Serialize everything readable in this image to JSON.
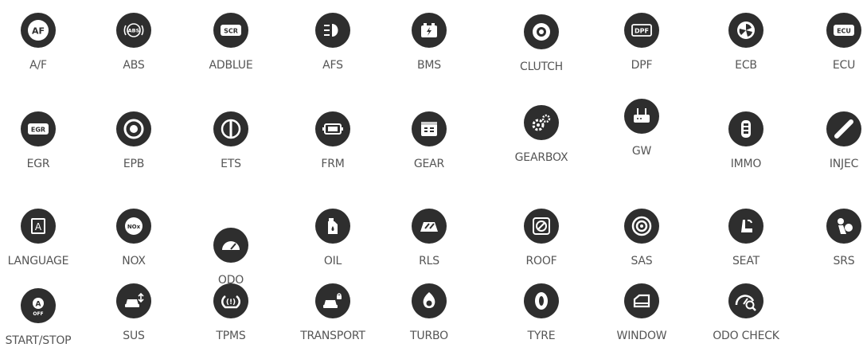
{
  "functions": [
    {
      "label": "A/F",
      "icon": "af-icon",
      "glyph": "AF"
    },
    {
      "label": "ABS",
      "icon": "abs-icon",
      "glyph": "ABS"
    },
    {
      "label": "ADBLUE",
      "icon": "scr-icon",
      "glyph": "SCR"
    },
    {
      "label": "AFS",
      "icon": "headlight-icon"
    },
    {
      "label": "BMS",
      "icon": "battery-icon"
    },
    {
      "label": "CLUTCH",
      "icon": "clutch-icon"
    },
    {
      "label": "DPF",
      "icon": "dpf-icon",
      "glyph": "DPF"
    },
    {
      "label": "ECB",
      "icon": "ecb-icon"
    },
    {
      "label": "ECU",
      "icon": "ecu-icon",
      "glyph": "ECU"
    },
    {
      "label": "EGR",
      "icon": "egr-icon",
      "glyph": "EGR"
    },
    {
      "label": "EPB",
      "icon": "parking-brake-icon"
    },
    {
      "label": "ETS",
      "icon": "throttle-icon"
    },
    {
      "label": "FRM",
      "icon": "frm-module-icon"
    },
    {
      "label": "GEAR",
      "icon": "gear-window-icon"
    },
    {
      "label": "GEARBOX",
      "icon": "gearbox-icon"
    },
    {
      "label": "GW",
      "icon": "gateway-icon"
    },
    {
      "label": "IMMO",
      "icon": "key-fob-icon"
    },
    {
      "label": "INJEC",
      "icon": "injector-icon"
    },
    {
      "label": "LANGUAGE",
      "icon": "language-icon",
      "glyph": "A"
    },
    {
      "label": "NOX",
      "icon": "nox-icon",
      "glyph": "NOx"
    },
    {
      "label": "ODO",
      "icon": "odometer-icon"
    },
    {
      "label": "OIL",
      "icon": "oil-icon"
    },
    {
      "label": "RLS",
      "icon": "rain-light-sensor-icon"
    },
    {
      "label": "ROOF",
      "icon": "sunroof-icon"
    },
    {
      "label": "SAS",
      "icon": "steering-angle-icon"
    },
    {
      "label": "SEAT",
      "icon": "seat-icon"
    },
    {
      "label": "SRS",
      "icon": "airbag-icon"
    },
    {
      "label": "START/STOP",
      "icon": "start-stop-icon",
      "glyph": "A",
      "glyph2": "OFF"
    },
    {
      "label": "SUS",
      "icon": "suspension-icon"
    },
    {
      "label": "TPMS",
      "icon": "tpms-icon"
    },
    {
      "label": "TRANSPORT",
      "icon": "transport-mode-icon"
    },
    {
      "label": "TURBO",
      "icon": "turbo-icon"
    },
    {
      "label": "TYRE",
      "icon": "tyre-icon"
    },
    {
      "label": "WINDOW",
      "icon": "window-icon"
    },
    {
      "label": "ODO CHECK",
      "icon": "odo-check-icon"
    }
  ]
}
